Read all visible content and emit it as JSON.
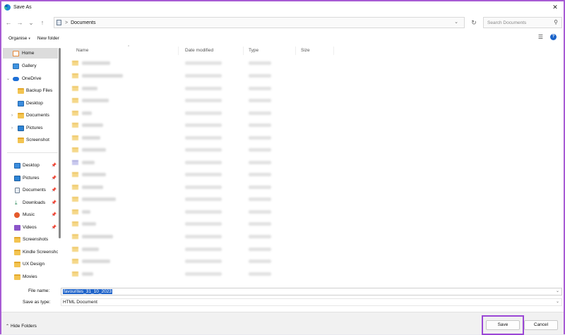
{
  "window": {
    "title": "Save As",
    "close_glyph": "✕"
  },
  "address_bar": {
    "back_glyph": "←",
    "forward_glyph": "→",
    "recent_glyph": "⌄",
    "up_glyph": "↑",
    "separator": ">",
    "path": "Documents",
    "dropdown_glyph": "⌄",
    "refresh_glyph": "↻",
    "search_placeholder": "Search Documents",
    "search_glyph": "⚲"
  },
  "toolbar": {
    "organise_label": "Organise",
    "new_folder_label": "New folder",
    "view_glyph": "☰",
    "help_glyph": "?"
  },
  "navigation": {
    "items": [
      {
        "label": "Home",
        "icon": "home-icon",
        "selected": true
      },
      {
        "label": "Gallery",
        "icon": "gallery-icon"
      },
      {
        "label": "OneDrive",
        "icon": "cloud-icon",
        "expander": "⌄"
      },
      {
        "label": "Backup Files",
        "icon": "folder-icon"
      },
      {
        "label": "Desktop",
        "icon": "desktop-icon"
      },
      {
        "label": "Documents",
        "icon": "folder-icon",
        "expander": "›"
      },
      {
        "label": "Pictures",
        "icon": "pictures-icon",
        "expander": "›"
      },
      {
        "label": "Screenshot",
        "icon": "folder-icon"
      },
      {
        "label": "Desktop",
        "icon": "desktop-icon",
        "pinned": true
      },
      {
        "label": "Pictures",
        "icon": "pictures-icon",
        "pinned": true
      },
      {
        "label": "Documents",
        "icon": "documents-icon",
        "pinned": true
      },
      {
        "label": "Downloads",
        "icon": "downloads-icon",
        "pinned": true
      },
      {
        "label": "Music",
        "icon": "music-icon",
        "pinned": true
      },
      {
        "label": "Videos",
        "icon": "videos-icon",
        "pinned": true
      },
      {
        "label": "Screenshots",
        "icon": "folder-icon"
      },
      {
        "label": "Kindle Screenshot",
        "icon": "folder-icon"
      },
      {
        "label": "UX Design",
        "icon": "folder-icon"
      },
      {
        "label": "Movies",
        "icon": "folder-icon"
      }
    ],
    "pin_glyph": "📌"
  },
  "columns": {
    "name": "Name",
    "date_modified": "Date modified",
    "type": "Type",
    "size": "Size"
  },
  "fields": {
    "file_name_label": "File name:",
    "file_name_value": "favourites_31_10_2023",
    "save_as_type_label": "Save as type:",
    "save_as_type_value": "HTML Document",
    "dropdown_glyph": "⌄"
  },
  "footer": {
    "hide_folders_label": "Hide Folders",
    "hide_caret": "⌃",
    "save_label": "Save",
    "cancel_label": "Cancel"
  },
  "colors": {
    "accent": "#1f63c9",
    "highlight": "#9b47d6",
    "folder": "#f3c451"
  }
}
